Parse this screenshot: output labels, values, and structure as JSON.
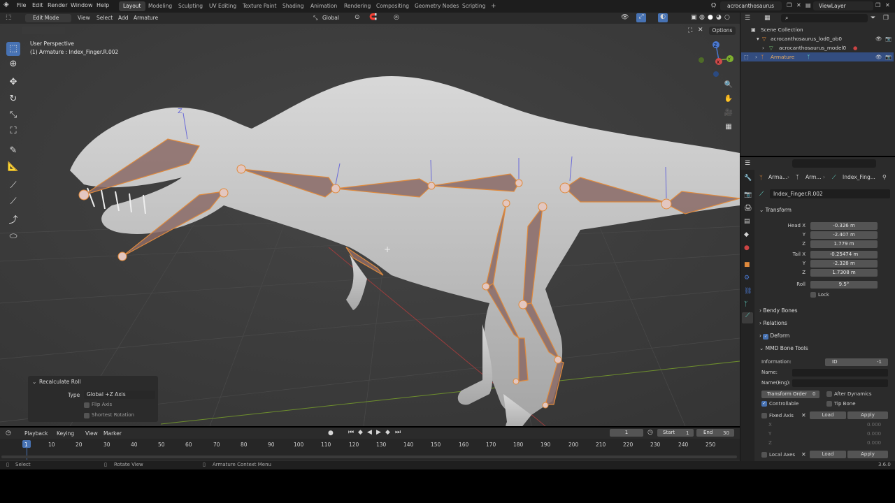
{
  "menus": [
    "File",
    "Edit",
    "Render",
    "Window",
    "Help"
  ],
  "workspaces": [
    "Layout",
    "Modeling",
    "Sculpting",
    "UV Editing",
    "Texture Paint",
    "Shading",
    "Animation",
    "Rendering",
    "Compositing",
    "Geometry Nodes",
    "Scripting"
  ],
  "active_workspace": "Layout",
  "add_workspace": "+",
  "scene_name": "acrocanthosaurus",
  "view_layer": "ViewLayer",
  "header": {
    "mode": "Edit Mode",
    "menus": [
      "View",
      "Select",
      "Add",
      "Armature"
    ],
    "transform_orientation": "Global",
    "options": "Options"
  },
  "viewport": {
    "perspective": "User Perspective",
    "active_object": "(1) Armature : Index_Finger.R.002",
    "gizmo_axes": {
      "z": "Z",
      "x": "X",
      "y": "Y"
    },
    "bone_axis_label": "Z"
  },
  "redo_panel": {
    "title": "Recalculate Roll",
    "type_label": "Type",
    "type_value": "Global +Z Axis",
    "flip_axis": "Flip Axis",
    "shortest_rotation": "Shortest Rotation"
  },
  "outliner": {
    "collection": "Scene Collection",
    "items": [
      {
        "label": "acrocanthosaurus_lod0_ob0",
        "level": 1,
        "selected": false
      },
      {
        "label": "acrocanthosaurus_model0",
        "level": 2,
        "selected": false
      },
      {
        "label": "Armature",
        "level": 1,
        "selected": true
      }
    ]
  },
  "properties": {
    "breadcrumb": [
      "Arma...",
      "Arm...",
      "Index_Fing..."
    ],
    "bone_name": "Index_Finger.R.002",
    "transform": {
      "title": "Transform",
      "head_x_label": "Head X",
      "head_x": "-0.326 m",
      "head_y_label": "Y",
      "head_y": "-2.407 m",
      "head_z_label": "Z",
      "head_z": "1.779 m",
      "tail_x_label": "Tail X",
      "tail_x": "-0.25474 m",
      "tail_y_label": "Y",
      "tail_y": "-2.328 m",
      "tail_z_label": "Z",
      "tail_z": "1.7308 m",
      "roll_label": "Roll",
      "roll": "9.5°",
      "lock": "Lock"
    },
    "panels": [
      "Bendy Bones",
      "Relations",
      "Deform"
    ],
    "mmd": {
      "title": "MMD Bone Tools",
      "information_label": "Information:",
      "id_label": "ID",
      "id_value": "-1",
      "name_label": "Name:",
      "name_eng_label": "Name(Eng):",
      "transform_order_label": "Transform Order",
      "transform_order_value": "0",
      "after_dynamics": "After Dynamics",
      "controllable": "Controllable",
      "tip_bone": "Tip Bone",
      "fixed_axis": "Fixed Axis",
      "load": "Load",
      "apply": "Apply",
      "x_label": "X",
      "y_label": "Y",
      "z_label": "Z",
      "x_val": "0.000",
      "y_val": "0.000",
      "z_val": "0.000",
      "local_axes": "Local Axes"
    }
  },
  "timeline": {
    "menus": [
      "Playback",
      "Keying",
      "View",
      "Marker"
    ],
    "current_frame": "1",
    "start_label": "Start",
    "start": "1",
    "end_label": "End",
    "end": "30",
    "frames": [
      "1",
      "10",
      "20",
      "30",
      "40",
      "50",
      "60",
      "70",
      "80",
      "90",
      "100",
      "110",
      "120",
      "130",
      "140",
      "150",
      "160",
      "170",
      "180",
      "190",
      "200",
      "210",
      "220",
      "230",
      "240",
      "250"
    ]
  },
  "status": {
    "select": "Select",
    "rotate_view": "Rotate View",
    "context_menu": "Armature Context Menu",
    "version": "3.6.0"
  },
  "colors": {
    "accent": "#4772b3",
    "bone_outline": "#e08a3c",
    "bone_fill": "#8a6a66",
    "model": "#c8c8c8"
  }
}
